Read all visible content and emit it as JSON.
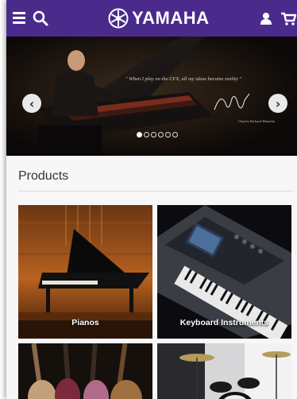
{
  "header": {
    "brand": "YAMAHA",
    "icons": [
      "menu-icon",
      "search-icon",
      "yamaha-logo-icon",
      "account-icon",
      "cart-icon"
    ],
    "background": "#4a2b8c"
  },
  "hero": {
    "quote": "\" When I play on the CFX, all my ideas become reality \"",
    "signature_caption": "Charles Richard-Hamelin",
    "slide_count": 6,
    "active_slide": 1
  },
  "products": {
    "title": "Products",
    "items": [
      {
        "label": "Pianos"
      },
      {
        "label": "Keyboard Instruments"
      },
      {
        "label": ""
      },
      {
        "label": ""
      }
    ]
  }
}
